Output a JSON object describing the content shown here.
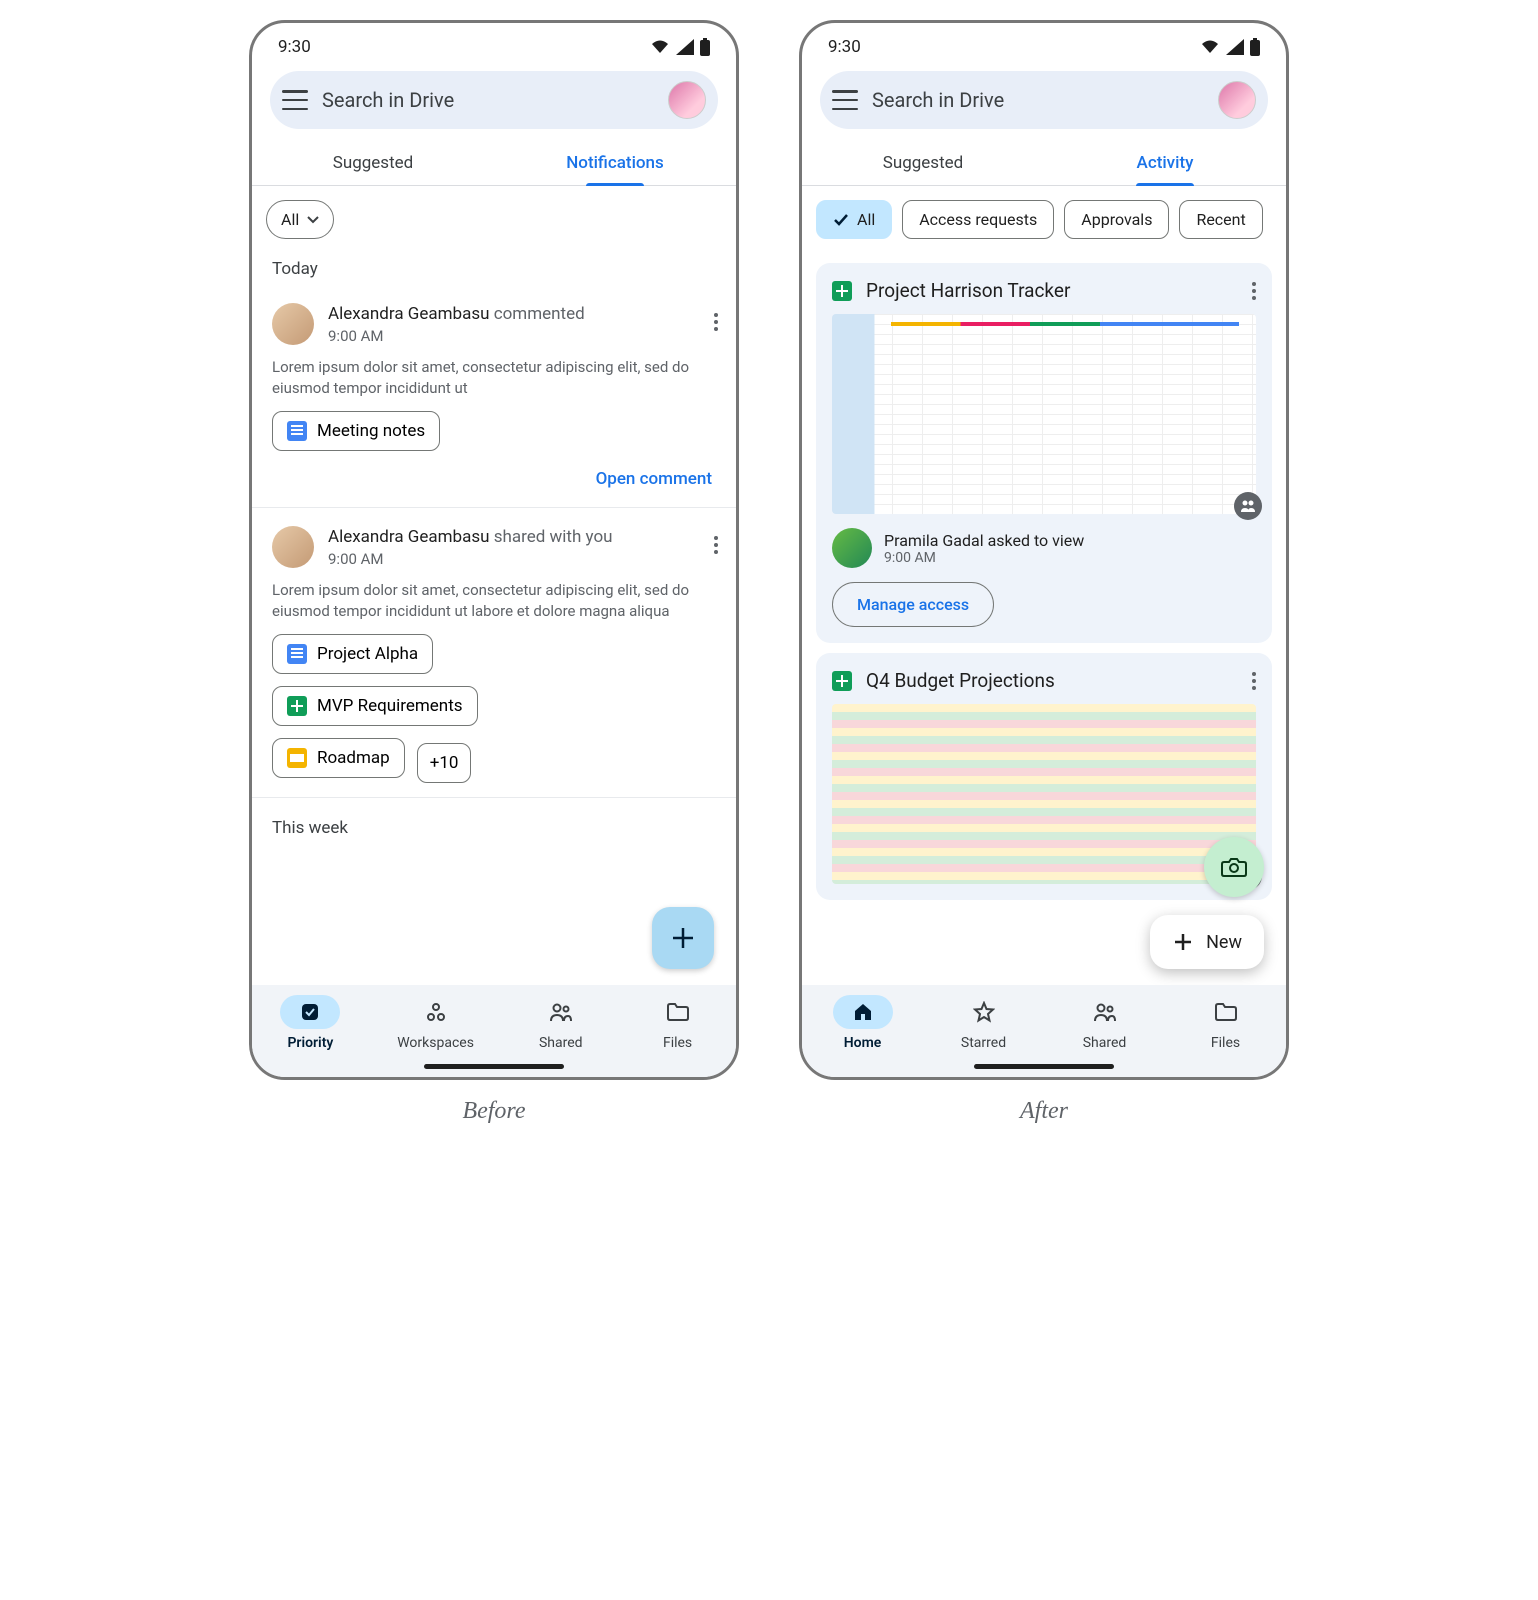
{
  "status_time": "9:30",
  "search_placeholder": "Search in Drive",
  "before": {
    "caption": "Before",
    "tabs": [
      "Suggested",
      "Notifications"
    ],
    "active_tab": 1,
    "filter_chip": "All",
    "sections": {
      "today": "Today",
      "this_week": "This week"
    },
    "notif1": {
      "person": "Alexandra Geambasu",
      "verb": "commented",
      "time": "9:00 AM",
      "body": "Lorem ipsum dolor sit amet, consectetur adipiscing elit, sed do eiusmod tempor incididunt ut",
      "file": "Meeting notes",
      "action": "Open comment"
    },
    "notif2": {
      "person": "Alexandra Geambasu",
      "verb": "shared with you",
      "time": "9:00 AM",
      "body": "Lorem ipsum dolor sit amet, consectetur adipiscing elit, sed do eiusmod tempor incididunt ut labore et dolore magna aliqua",
      "files": [
        "Project Alpha",
        "MVP Requirements",
        "Roadmap"
      ],
      "overflow": "+10"
    },
    "nav": [
      "Priority",
      "Workspaces",
      "Shared",
      "Files"
    ],
    "active_nav": 0
  },
  "after": {
    "caption": "After",
    "tabs": [
      "Suggested",
      "Activity"
    ],
    "active_tab": 1,
    "filter_chips": [
      "All",
      "Access requests",
      "Approvals",
      "Recent"
    ],
    "active_chip": 0,
    "card1": {
      "title": "Project Harrison Tracker",
      "person": "Pramila Gadal",
      "verb": "asked to view",
      "time": "9:00 AM",
      "action": "Manage access"
    },
    "card2": {
      "title": "Q4 Budget Projections"
    },
    "fab_label": "New",
    "nav": [
      "Home",
      "Starred",
      "Shared",
      "Files"
    ],
    "active_nav": 0
  }
}
